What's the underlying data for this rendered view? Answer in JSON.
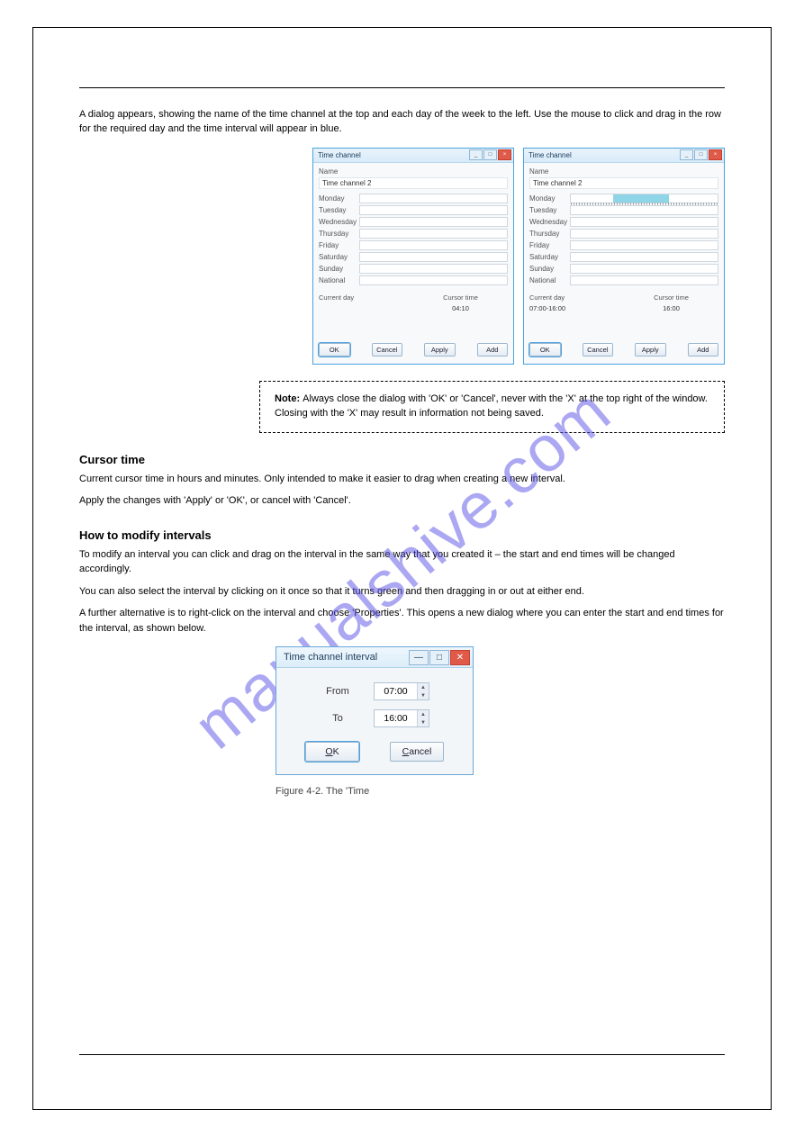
{
  "watermark": "manualshive.com",
  "intro": "A dialog appears, showing the name of the time channel at the top and each day of the week to the left. Use the mouse to click and drag in the row for the required day and the time interval will appear in blue.",
  "dialog_a": {
    "title": "Time channel",
    "name_label": "Name",
    "name_value": "Time channel 2",
    "days": [
      "Monday",
      "Tuesday",
      "Wednesday",
      "Thursday",
      "Friday",
      "Saturday",
      "Sunday",
      "National"
    ],
    "current_day_label": "Current day",
    "current_day_value": "",
    "cursor_time_label": "Cursor time",
    "cursor_time_value": "04:10",
    "buttons": {
      "ok": "OK",
      "cancel": "Cancel",
      "apply": "Apply",
      "add": "Add"
    }
  },
  "dialog_b": {
    "title": "Time channel",
    "name_label": "Name",
    "name_value": "Time channel 2",
    "days": [
      "Monday",
      "Tuesday",
      "Wednesday",
      "Thursday",
      "Friday",
      "Saturday",
      "Sunday",
      "National"
    ],
    "fill": {
      "day": "Monday",
      "start_pct": 29,
      "end_pct": 67
    },
    "current_day_label": "Current day",
    "current_day_value": "07:00-16:00",
    "cursor_time_label": "Cursor time",
    "cursor_time_value": "16:00",
    "buttons": {
      "ok": "OK",
      "cancel": "Cancel",
      "apply": "Apply",
      "add": "Add"
    }
  },
  "note": {
    "label": "Note: ",
    "text": "Always close the dialog with 'OK' or 'Cancel', never with the 'X' at the top right of the window. Closing with the 'X' may result in information not being saved."
  },
  "section_cursor": {
    "heading": "Cursor time",
    "p1": "Current cursor time in hours and minutes. Only intended to make it easier to drag when creating a new interval.",
    "p2": "Apply the changes with 'Apply' or 'OK', or cancel with 'Cancel'."
  },
  "section_modify": {
    "heading": "How to modify intervals",
    "p1": "To modify an interval you can click and drag on the interval in the same way that you created it – the start and end times will be changed accordingly.",
    "p2": "You can also select the interval by clicking on it once so that it turns green and then dragging in or out at either end.",
    "p3": "A further alternative is to right-click on the interval and choose 'Properties'. This opens a new dialog where you can enter the start and end times for the interval, as shown below."
  },
  "interval_dialog": {
    "title": "Time channel interval",
    "from_label": "From",
    "from_value": "07:00",
    "to_label": "To",
    "to_value": "16:00",
    "ok": "OK",
    "cancel": "Cancel"
  },
  "fig_caption": "Figure 4-2. The 'Time "
}
